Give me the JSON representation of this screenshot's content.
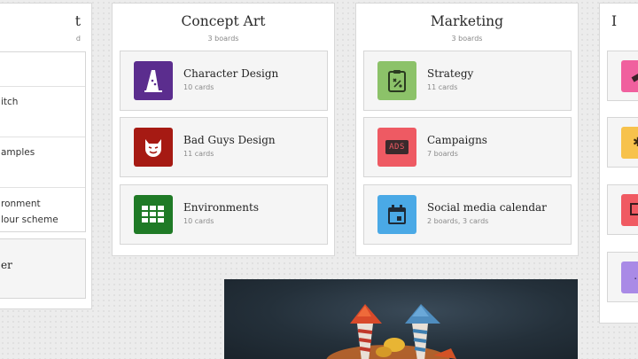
{
  "left_column": {
    "title_fragment": "t",
    "subtitle_fragment": "d",
    "items": [
      "itch",
      "amples",
      "ronment",
      "lour scheme",
      "er"
    ]
  },
  "columns": [
    {
      "title": "Concept Art",
      "subtitle": "3 boards",
      "boards": [
        {
          "name": "Character Design",
          "count": "10 cards",
          "icon": "sorting-hat-icon",
          "color": "#5b2d8e"
        },
        {
          "name": "Bad Guys Design",
          "count": "11 cards",
          "icon": "devil-face-icon",
          "color": "#a61a13"
        },
        {
          "name": "Environments",
          "count": "10 cards",
          "icon": "grid-icon",
          "color": "#1f7a26"
        }
      ]
    },
    {
      "title": "Marketing",
      "subtitle": "3 boards",
      "boards": [
        {
          "name": "Strategy",
          "count": "11 cards",
          "icon": "clipboard-icon",
          "color": "#8cc269"
        },
        {
          "name": "Campaigns",
          "count": "7 boards",
          "icon": "ads-icon",
          "color": "#ee5a63",
          "icon_text": "ADS"
        },
        {
          "name": "Social media calendar",
          "count": "2 boards, 3 cards",
          "icon": "calendar-icon",
          "color": "#4aa9e6"
        }
      ]
    }
  ],
  "right_column": {
    "title_fragment": "I",
    "tiles": [
      {
        "color": "#f0609e",
        "icon": "pencil-icon"
      },
      {
        "color": "#f7c24c",
        "icon": "flower-icon"
      },
      {
        "color": "#f05a62",
        "icon": "frame-icon"
      },
      {
        "color": "#a98ae6",
        "icon": "more-icon",
        "icon_text": "..."
      }
    ]
  }
}
